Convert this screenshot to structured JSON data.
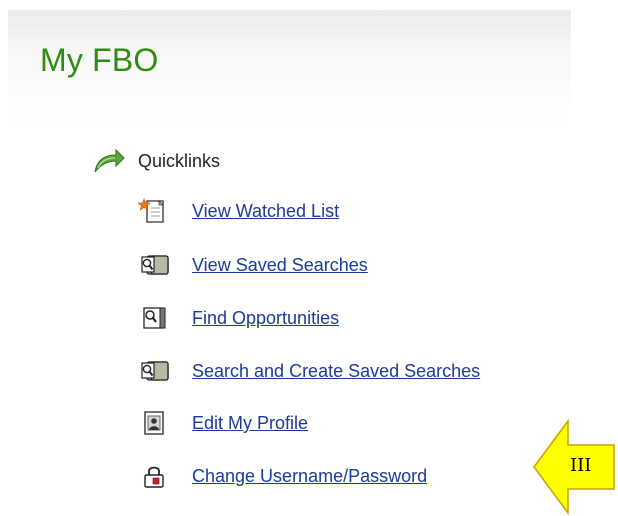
{
  "page": {
    "title": "My FBO"
  },
  "quicklinks": {
    "heading": "Quicklinks",
    "items": [
      {
        "label": "View Watched List",
        "icon": "watched-list-icon"
      },
      {
        "label": "View Saved Searches",
        "icon": "saved-searches-icon"
      },
      {
        "label": "Find Opportunities",
        "icon": "find-opportunities-icon"
      },
      {
        "label": "Search and Create Saved Searches",
        "icon": "create-saved-searches-icon"
      },
      {
        "label": "Edit My Profile",
        "icon": "profile-icon"
      },
      {
        "label": "Change Username/Password",
        "icon": "lock-icon"
      }
    ]
  },
  "annotation": {
    "label": "III",
    "fill": "#ffff00"
  },
  "colors": {
    "title": "#2f8a10",
    "link": "#1a3a9c",
    "text": "#222222"
  }
}
